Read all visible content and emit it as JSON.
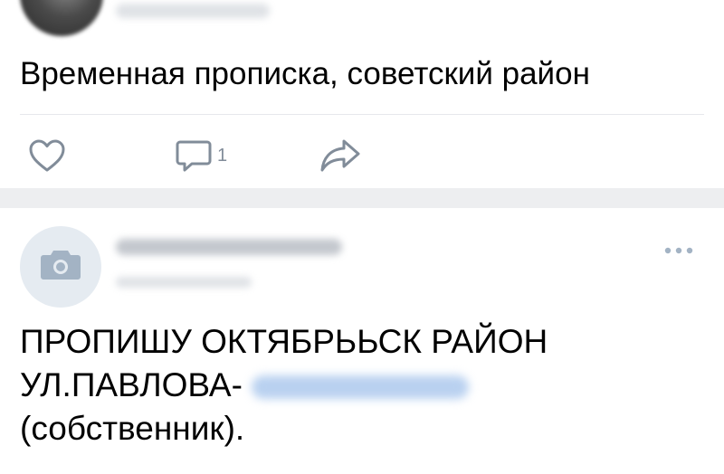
{
  "post1": {
    "text": "Временная прописка, советский район",
    "comment_count": "1"
  },
  "post2": {
    "line1": "ПРОПИШУ ОКТЯБРЬЬСК РАЙОН",
    "line2": "УЛ.ПАВЛОВА-",
    "line3": "(собственник)."
  },
  "colors": {
    "icon_gray": "#818c99",
    "separator": "#edeef0",
    "avatar_placeholder_bg": "#e5ebf1",
    "camera_icon": "#a3b3c4"
  },
  "icons": [
    "like-icon",
    "comment-icon",
    "share-icon",
    "camera-icon",
    "more-icon"
  ]
}
